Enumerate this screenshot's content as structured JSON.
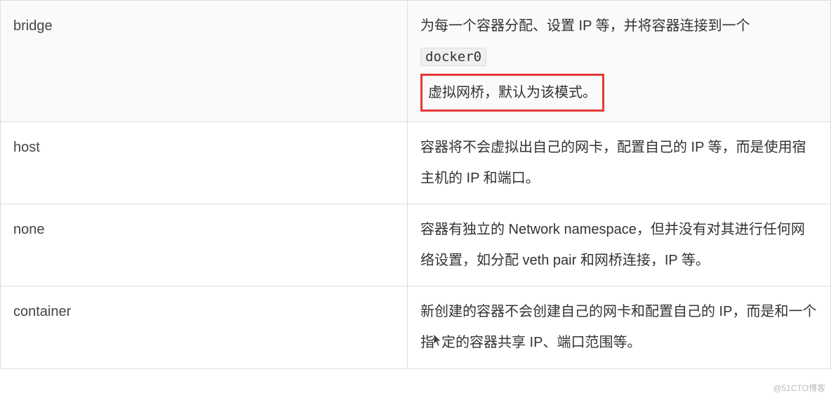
{
  "rows": [
    {
      "mode": "bridge",
      "desc_pre": "为每一个容器分配、设置 IP 等，并将容器连接到一个 ",
      "code": "docker0",
      "highlight": "虚拟网桥，默认为该模式。"
    },
    {
      "mode": "host",
      "desc": "容器将不会虚拟出自己的网卡，配置自己的 IP 等，而是使用宿主机的 IP 和端口。"
    },
    {
      "mode": "none",
      "desc": "容器有独立的 Network namespace，但并没有对其进行任何网络设置，如分配 veth pair 和网桥连接，IP 等。"
    },
    {
      "mode": "container",
      "desc_a": "新创建的容器不会创建自己的网卡和配置自己的 IP，而是和一个指",
      "desc_b": "定的容器共享 IP、端口范围等。"
    }
  ],
  "watermark": "@51CTO博客"
}
